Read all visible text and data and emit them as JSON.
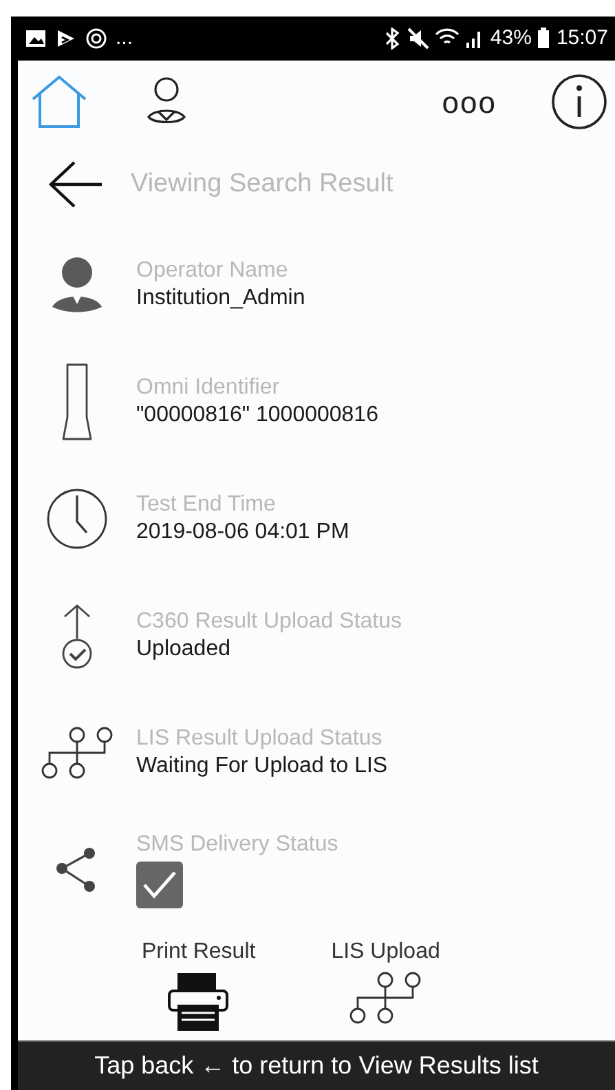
{
  "status_bar": {
    "overflow": "...",
    "battery": "43%",
    "time": "15:07"
  },
  "toolbar": {
    "home_selected": true,
    "more": "ooo"
  },
  "header": {
    "title": "Viewing Search Result"
  },
  "fields": [
    {
      "kind": "operator",
      "label": "Operator Name",
      "value": "Institution_Admin"
    },
    {
      "kind": "identifier",
      "label": "Omni Identifier",
      "value": "\"00000816\" 1000000816"
    },
    {
      "kind": "time",
      "label": "Test End Time",
      "value": "2019-08-06 04:01 PM"
    },
    {
      "kind": "upload",
      "label": "C360 Result Upload Status",
      "value": "Uploaded"
    },
    {
      "kind": "lis",
      "label": "LIS Result Upload Status",
      "value": "Waiting For Upload to LIS"
    },
    {
      "kind": "sms",
      "label": "SMS Delivery Status",
      "checked": true
    }
  ],
  "actions": [
    {
      "kind": "print",
      "label": "Print Result"
    },
    {
      "kind": "lis",
      "label": "LIS Upload"
    }
  ],
  "footer": {
    "hint": "Tap back ← to return to View Results list"
  }
}
